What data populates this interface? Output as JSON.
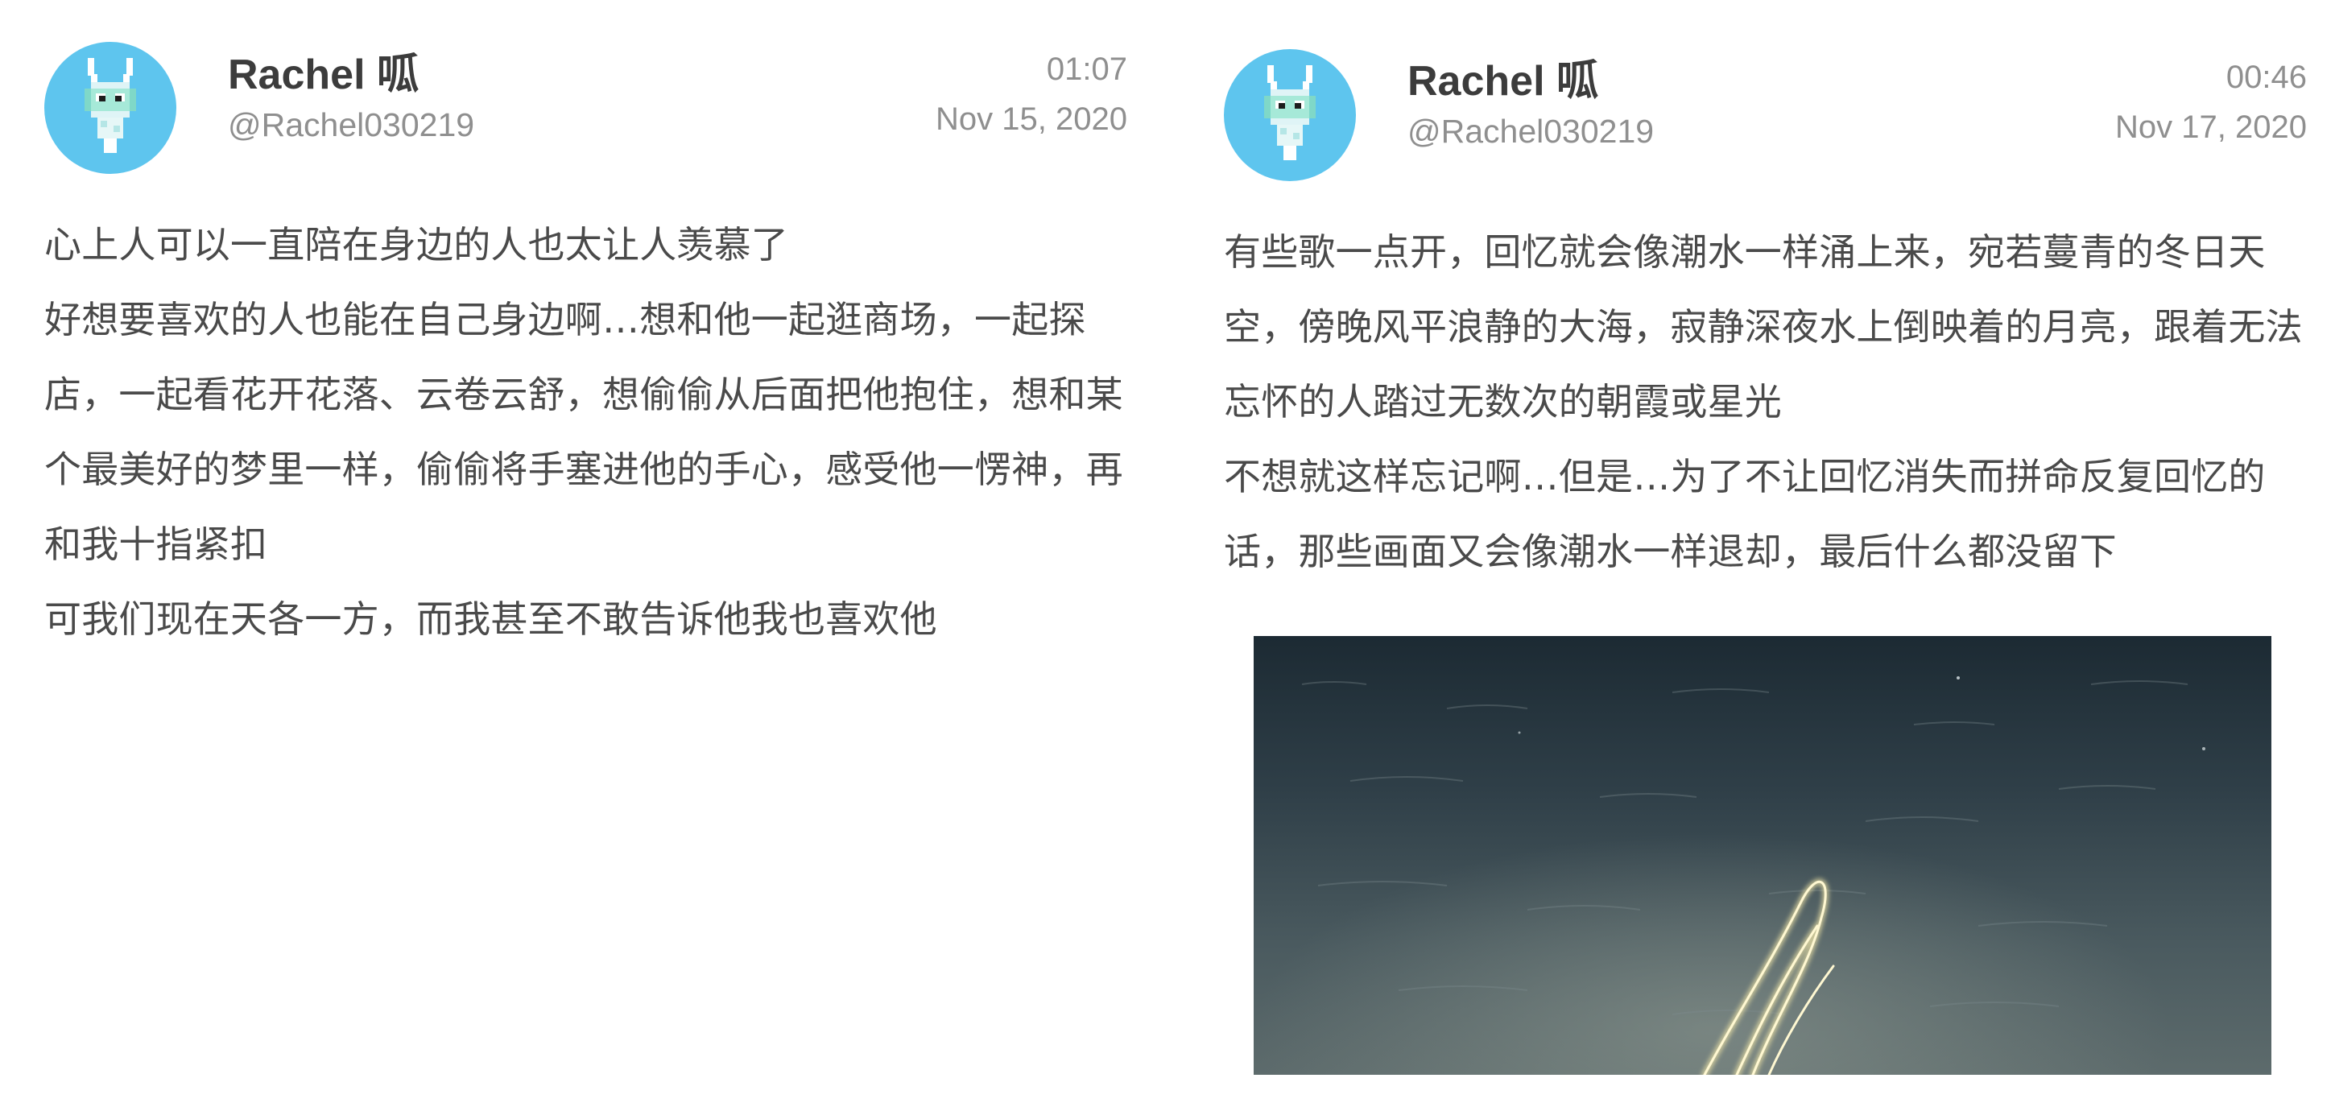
{
  "colors": {
    "avatar_bg": "#5ec5ee",
    "text_primary": "#3c3c3c",
    "text_secondary": "#8f8f8f"
  },
  "posts": [
    {
      "author_name": "Rachel 呱",
      "handle": "@Rachel030219",
      "time": "01:07",
      "date": "Nov 15, 2020",
      "avatar_icon": "pixel-rabbit-icon",
      "paragraphs": [
        "心上人可以一直陪在身边的人也太让人羡慕了",
        "好想要喜欢的人也能在自己身边啊…想和他一起逛商场，一起探店，一起看花开花落、云卷云舒，想偷偷从后面把他抱住，想和某个最美好的梦里一样，偷偷将手塞进他的手心，感受他一愣神，再和我十指紧扣",
        "可我们现在天各一方，而我甚至不敢告诉他我也喜欢他"
      ]
    },
    {
      "author_name": "Rachel 呱",
      "handle": "@Rachel030219",
      "time": "00:46",
      "date": "Nov 17, 2020",
      "avatar_icon": "pixel-rabbit-icon",
      "paragraphs": [
        "有些歌一点开，回忆就会像潮水一样涌上来，宛若蔓青的冬日天空，傍晚风平浪静的大海，寂静深夜水上倒映着的月亮，跟着无法忘怀的人踏过无数次的朝霞或星光",
        "不想就这样忘记啊…但是…为了不让回忆消失而拼命反复回忆的话，那些画面又会像潮水一样退却，最后什么都没留下"
      ],
      "image": "night-water-light-trail-photo"
    }
  ]
}
